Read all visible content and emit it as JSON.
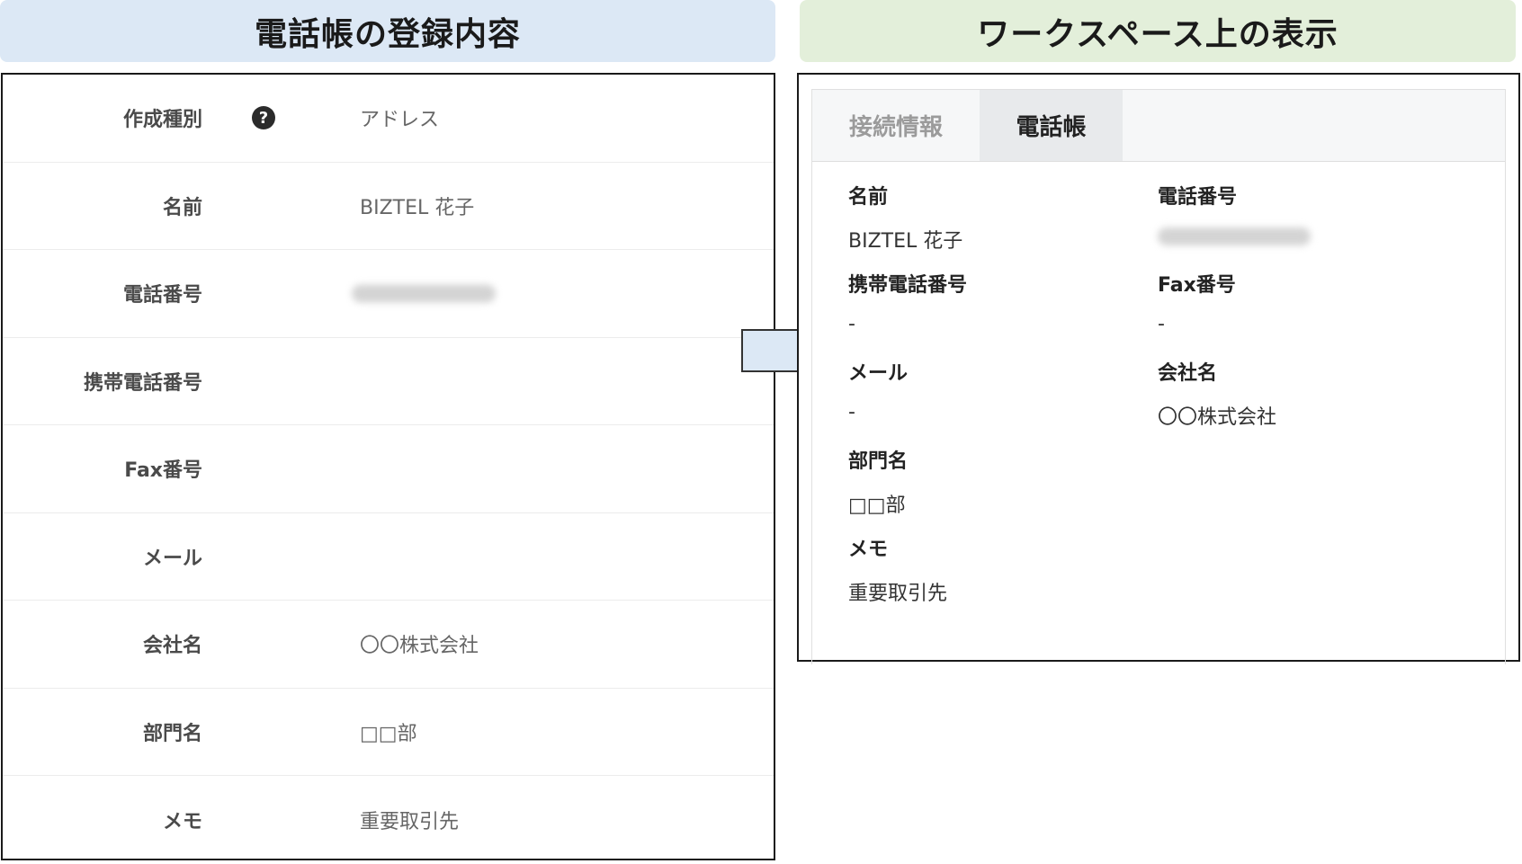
{
  "banners": {
    "left": "電話帳の登録内容",
    "right": "ワークスペース上の表示"
  },
  "registration_form": {
    "help_icon_glyph": "?",
    "rows": [
      {
        "label": "作成種別",
        "value": "アドレス"
      },
      {
        "label": "名前",
        "value": "BIZTEL 花子"
      },
      {
        "label": "電話番号",
        "value": ""
      },
      {
        "label": "携帯電話番号",
        "value": ""
      },
      {
        "label": "Fax番号",
        "value": ""
      },
      {
        "label": "メール",
        "value": ""
      },
      {
        "label": "会社名",
        "value": "〇〇株式会社"
      },
      {
        "label": "部門名",
        "value": "□□部"
      },
      {
        "label": "メモ",
        "value": "重要取引先"
      }
    ]
  },
  "workspace": {
    "tabs": [
      {
        "label": "接続情報"
      },
      {
        "label": "電話帳"
      }
    ],
    "fields": {
      "name": {
        "label": "名前",
        "value": "BIZTEL 花子"
      },
      "phone": {
        "label": "電話番号",
        "value": ""
      },
      "mobile": {
        "label": "携帯電話番号",
        "value": "-"
      },
      "fax": {
        "label": "Fax番号",
        "value": "-"
      },
      "mail": {
        "label": "メール",
        "value": "-"
      },
      "company": {
        "label": "会社名",
        "value": "〇〇株式会社"
      },
      "department": {
        "label": "部門名",
        "value": "□□部"
      },
      "memo": {
        "label": "メモ",
        "value": "重要取引先"
      }
    }
  },
  "colors": {
    "left_banner": "#dce8f5",
    "right_banner": "#e3efda",
    "arrow_fill": "#dce8f5",
    "arrow_stroke": "#333333"
  }
}
